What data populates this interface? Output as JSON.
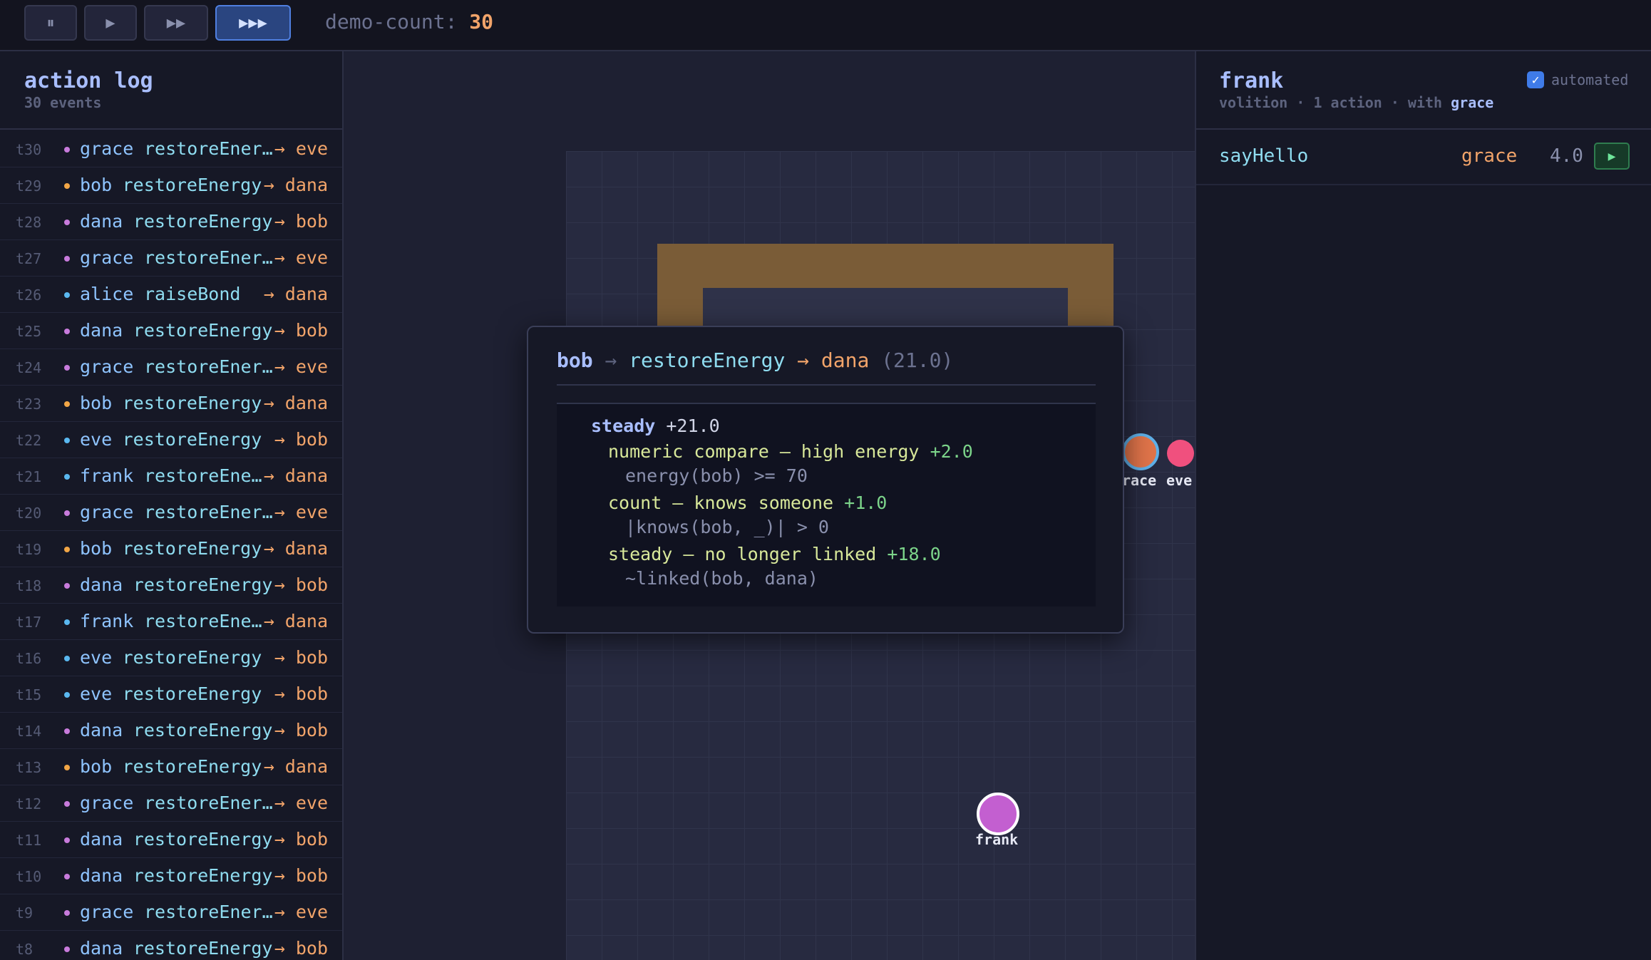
{
  "toolbar": {
    "buttons": [
      {
        "icon": "pause-icon",
        "glyph": "⏸"
      },
      {
        "icon": "play-icon",
        "glyph": "▶"
      },
      {
        "icon": "fast-forward-icon",
        "glyph": "▶▶"
      },
      {
        "icon": "fastest-forward-icon",
        "glyph": "▶▶▶"
      }
    ],
    "demo_count_label": "demo-count:",
    "demo_count_value": "30"
  },
  "log": {
    "title": "action log",
    "subtitle": "30 events",
    "rows": [
      {
        "t": "t30",
        "actor": "grace",
        "action": "restoreEner…",
        "target": "→ eve",
        "dot": "#c87bdc"
      },
      {
        "t": "t29",
        "actor": "bob",
        "action": "restoreEnergy",
        "target": "→ dana",
        "dot": "#f2a646"
      },
      {
        "t": "t28",
        "actor": "dana",
        "action": "restoreEnergy",
        "target": "→ bob",
        "dot": "#c87bdc"
      },
      {
        "t": "t27",
        "actor": "grace",
        "action": "restoreEner…",
        "target": "→ eve",
        "dot": "#c87bdc"
      },
      {
        "t": "t26",
        "actor": "alice",
        "action": "raiseBond",
        "target": "→ dana",
        "dot": "#5ab8f0"
      },
      {
        "t": "t25",
        "actor": "dana",
        "action": "restoreEnergy",
        "target": "→ bob",
        "dot": "#c87bdc"
      },
      {
        "t": "t24",
        "actor": "grace",
        "action": "restoreEner…",
        "target": "→ eve",
        "dot": "#c87bdc"
      },
      {
        "t": "t23",
        "actor": "bob",
        "action": "restoreEnergy",
        "target": "→ dana",
        "dot": "#f2a646"
      },
      {
        "t": "t22",
        "actor": "eve",
        "action": "restoreEnergy",
        "target": "→ bob",
        "dot": "#5ab8f0"
      },
      {
        "t": "t21",
        "actor": "frank",
        "action": "restoreEne…",
        "target": "→ dana",
        "dot": "#5ab8f0"
      },
      {
        "t": "t20",
        "actor": "grace",
        "action": "restoreEner…",
        "target": "→ eve",
        "dot": "#c87bdc"
      },
      {
        "t": "t19",
        "actor": "bob",
        "action": "restoreEnergy",
        "target": "→ dana",
        "dot": "#f2a646"
      },
      {
        "t": "t18",
        "actor": "dana",
        "action": "restoreEnergy",
        "target": "→ bob",
        "dot": "#c87bdc"
      },
      {
        "t": "t17",
        "actor": "frank",
        "action": "restoreEne…",
        "target": "→ dana",
        "dot": "#5ab8f0"
      },
      {
        "t": "t16",
        "actor": "eve",
        "action": "restoreEnergy",
        "target": "→ bob",
        "dot": "#5ab8f0"
      },
      {
        "t": "t15",
        "actor": "eve",
        "action": "restoreEnergy",
        "target": "→ bob",
        "dot": "#5ab8f0"
      },
      {
        "t": "t14",
        "actor": "dana",
        "action": "restoreEnergy",
        "target": "→ bob",
        "dot": "#c87bdc"
      },
      {
        "t": "t13",
        "actor": "bob",
        "action": "restoreEnergy",
        "target": "→ dana",
        "dot": "#f2a646"
      },
      {
        "t": "t12",
        "actor": "grace",
        "action": "restoreEner…",
        "target": "→ eve",
        "dot": "#c87bdc"
      },
      {
        "t": "t11",
        "actor": "dana",
        "action": "restoreEnergy",
        "target": "→ bob",
        "dot": "#c87bdc"
      },
      {
        "t": "t10",
        "actor": "dana",
        "action": "restoreEnergy",
        "target": "→ bob",
        "dot": "#c87bdc"
      },
      {
        "t": "t9",
        "actor": "grace",
        "action": "restoreEner…",
        "target": "→ eve",
        "dot": "#c87bdc"
      },
      {
        "t": "t8",
        "actor": "dana",
        "action": "restoreEnergy",
        "target": "→ bob",
        "dot": "#c87bdc"
      }
    ]
  },
  "canvas": {
    "agents": [
      {
        "name": "grace",
        "label": "race",
        "color": "#e0744a"
      },
      {
        "name": "eve",
        "label": "eve",
        "color": "#f0507e"
      },
      {
        "name": "frank",
        "label": "frank",
        "color": "#c35fd0"
      }
    ]
  },
  "tooltip": {
    "actor": "bob",
    "arrow1": "→",
    "action": "restoreEnergy",
    "arrow2": "→",
    "target": "dana",
    "score": "(21.0)",
    "head_label": "steady",
    "head_value": "+21.0",
    "rules": [
      {
        "name": "numeric compare — high energy",
        "value": "+2.0",
        "condition": "energy(bob) >= 70"
      },
      {
        "name": "count — knows someone",
        "value": "+1.0",
        "condition": "|knows(bob, _)| > 0"
      },
      {
        "name": "steady — no longer linked",
        "value": "+18.0",
        "condition": "~linked(bob, dana)"
      }
    ]
  },
  "inspector": {
    "name": "frank",
    "sub_prefix": "volition · 1 action · with",
    "sub_with": "grace",
    "automated_label": "automated",
    "automated_checked": "✓",
    "actions": [
      {
        "action": "sayHello",
        "target": "grace",
        "score": "4.0",
        "play": "▶"
      }
    ]
  }
}
